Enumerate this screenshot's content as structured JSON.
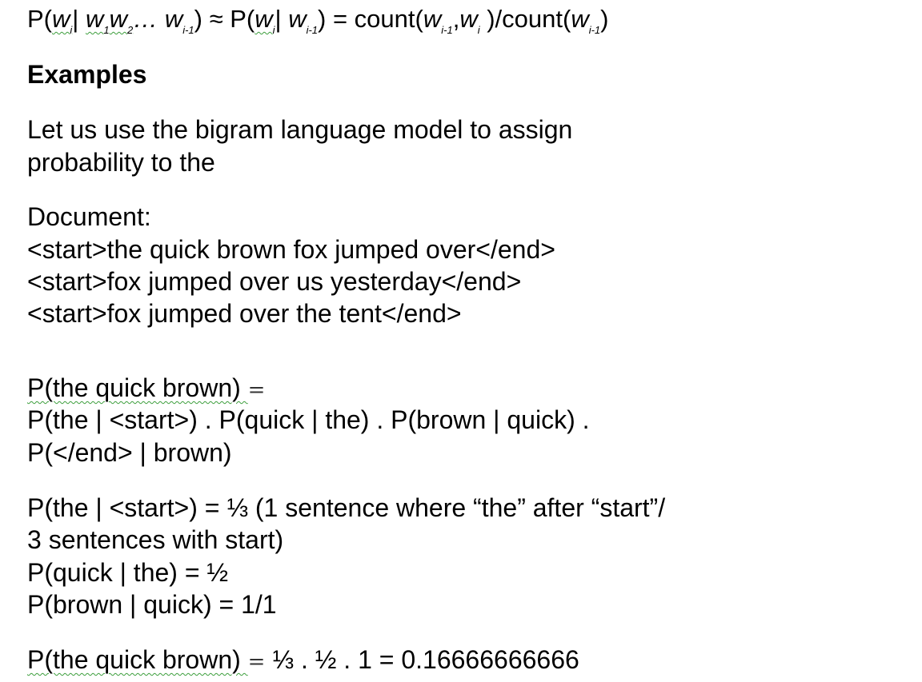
{
  "formula": {
    "lhs_p": "P(",
    "w_i": "w",
    "i": "i",
    "bar": "| ",
    "w1": "w",
    "sub1": "1",
    "w2": "w",
    "sub2": "2",
    "dots": "… ",
    "wim1": "w",
    "sub_im1": "i-1",
    "close_approx": ") ≈ ",
    "mid_p": "P(",
    "w_i_b": "w",
    "i_b": "i",
    "bar2": "| ",
    "w_im1_b": "w",
    "sub_im1_b": "i-1",
    "eq_count": ") = count(",
    "w_im1_c": "w",
    "sub_im1_c": "i-1",
    "comma": ",",
    "w_i_c": "w",
    "i_c": "i",
    "div_count": " )/count(",
    "w_im1_d": "w",
    "sub_im1_d": "i-1",
    "end": ")"
  },
  "heading": "Examples",
  "intro": [
    "Let us use the bigram language model to assign",
    "probability to the"
  ],
  "document": {
    "label": "Document:",
    "lines": [
      "<start>the quick brown fox jumped over</end>",
      "<start>fox jumped over us yesterday</end>",
      "<start>fox jumped over the tent</end>"
    ]
  },
  "expansion": {
    "line1_a": "P(the quick brown) ",
    "line1_eq": "=",
    "line2": "P(the | <start>) . P(quick | the) . P(brown | quick) .",
    "line3": "P(</end> | brown)"
  },
  "probs": [
    "P(the | <start>) = ⅓  (1 sentence where “the” after “start”/",
    "3 sentences with start)",
    "P(quick | the) = ½",
    "P(brown | quick) = 1/1"
  ],
  "result": {
    "a": "P(the quick brown) ",
    "eq": "=",
    "b": " ⅓ . ½ . 1 = 0.16666666666"
  }
}
